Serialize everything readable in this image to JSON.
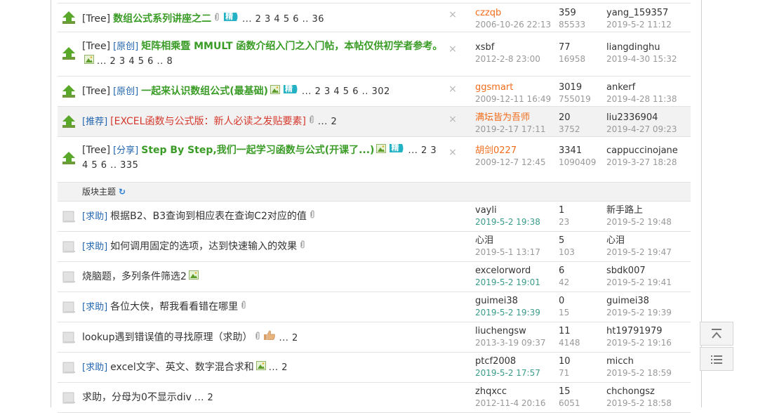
{
  "pinned": [
    {
      "tag": "[Tree]",
      "cat": "",
      "title": "数组公式系列讲座之二",
      "title_style": "green",
      "has_attach": true,
      "has_jing": true,
      "pages": "... 2  3  4  5  6 .. 36",
      "author": "czzqb",
      "author_orange": true,
      "date": "2006-10-26 22:13",
      "replies": "359",
      "views": "85533",
      "last": "yang_159357",
      "last_date": "2019-5-2 11:12",
      "two_line": false,
      "has_img": false
    },
    {
      "tag": "[Tree]",
      "cat": "[原创]",
      "title": "矩阵相乘暨 MMULT 函数介绍入门之入门帖，本帖仅供初学者参考。",
      "title_style": "green",
      "has_attach": false,
      "has_jing": false,
      "has_img": true,
      "pages": "... 2  3  4  5  6 .. 8",
      "author": "xsbf",
      "author_orange": false,
      "date": "2012-2-8 23:00",
      "replies": "77",
      "views": "16958",
      "last": "liangdinghu",
      "last_date": "2019-4-30 15:32",
      "two_line": true
    },
    {
      "tag": "[Tree]",
      "cat": "[原创]",
      "title": "一起来认识数组公式(最基础)",
      "title_style": "green",
      "has_attach": false,
      "has_jing": true,
      "has_img": true,
      "pages": "... 2  3  4  5  6 .. 302",
      "author": "ggsmart",
      "author_orange": true,
      "date": "2009-12-11 16:49",
      "replies": "3019",
      "views": "755019",
      "last": "ankerf",
      "last_date": "2019-4-28 11:38",
      "two_line": false
    },
    {
      "tag": "",
      "cat": "[推荐]",
      "title": "[EXCEL函数与公式版：新人必读之发贴要素]",
      "title_style": "red",
      "has_attach": true,
      "has_jing": false,
      "has_img": false,
      "pages": "... 2",
      "author": "满坛皆为吾师",
      "author_orange": true,
      "date": "2019-2-17 17:11",
      "replies": "20",
      "views": "3752",
      "last": "liu2336904",
      "last_date": "2019-4-27 09:23",
      "two_line": false,
      "highlight": true
    },
    {
      "tag": "[Tree]",
      "cat": "[分享]",
      "title": "Step By Step,我们一起学习函数与公式(开课了...)",
      "title_style": "green",
      "has_attach": false,
      "has_jing": true,
      "has_img": true,
      "pages": "... 2  3  4  5  6 .. 335",
      "author": "胡剑0227",
      "author_orange": true,
      "date": "2009-12-7 12:45",
      "replies": "3341",
      "views": "1090409",
      "last": "cappuccinojane",
      "last_date": "2019-3-27 18:28",
      "two_line": true
    }
  ],
  "section": {
    "label": "版块主题"
  },
  "threads": [
    {
      "cat": "[求助]",
      "title": "根据B2、B3查询到相应表在查询C2对应的值",
      "has_attach": true,
      "has_img": false,
      "has_thumb": false,
      "pages": "",
      "author": "vayli",
      "date": "2019-5-2 19:38",
      "date_new": true,
      "replies": "1",
      "views": "23",
      "last": "新手路上",
      "last_date": "2019-5-2 19:48"
    },
    {
      "cat": "[求助]",
      "title": "如何调用固定的选项，达到快速输入的效果",
      "has_attach": true,
      "has_img": false,
      "has_thumb": false,
      "pages": "",
      "author": "心泪",
      "date": "2019-5-1 13:17",
      "date_new": false,
      "replies": "5",
      "views": "103",
      "last": "心泪",
      "last_date": "2019-5-2 19:47"
    },
    {
      "cat": "",
      "title": "烧脑题，多列条件筛选2",
      "has_attach": false,
      "has_img": true,
      "has_thumb": false,
      "pages": "",
      "author": "excelorword",
      "date": "2019-5-2 19:01",
      "date_new": true,
      "replies": "6",
      "views": "42",
      "last": "sbdk007",
      "last_date": "2019-5-2 19:41"
    },
    {
      "cat": "[求助]",
      "title": "各位大侠，帮我看看错在哪里",
      "has_attach": true,
      "has_img": false,
      "has_thumb": false,
      "pages": "",
      "author": "guimei38",
      "date": "2019-5-2 19:39",
      "date_new": true,
      "replies": "0",
      "views": "15",
      "last": "guimei38",
      "last_date": "2019-5-2 19:39"
    },
    {
      "cat": "",
      "title": "lookup遇到错误值的寻找原理（求助）",
      "has_attach": true,
      "has_img": false,
      "has_thumb": true,
      "pages": "... 2",
      "author": "liuchengsw",
      "date": "2013-3-19 09:37",
      "date_new": false,
      "replies": "11",
      "views": "4148",
      "last": "ht19791979",
      "last_date": "2019-5-2 19:16"
    },
    {
      "cat": "[求助]",
      "title": "excel文字、英文、数字混合求和",
      "has_attach": false,
      "has_img": true,
      "has_thumb": false,
      "pages": "... 2",
      "author": "ptcf2008",
      "date": "2019-5-2 17:57",
      "date_new": true,
      "replies": "10",
      "views": "71",
      "last": "micch",
      "last_date": "2019-5-2 18:59"
    },
    {
      "cat": "",
      "title": "求助，分母为0不显示div",
      "has_attach": false,
      "has_img": false,
      "has_thumb": false,
      "pages": "... 2",
      "author": "zhqxcc",
      "date": "2012-11-4 20:16",
      "date_new": false,
      "replies": "15",
      "views": "6051",
      "last": "chchongsz",
      "last_date": "2019-5-2 18:58"
    }
  ],
  "labels": {
    "jing": "精"
  },
  "icons": {
    "pinned": "pin-up-arrow-icon",
    "normal": "folder-icon",
    "attach": "paperclip-icon",
    "image": "image-icon",
    "thumb": "thumbs-up-icon",
    "refresh": "refresh-icon",
    "close": "close-icon",
    "top": "back-to-top-icon",
    "list": "list-view-icon"
  },
  "colors": {
    "green": "#3a9c26",
    "red": "#d5382c",
    "orange": "#f26c1c",
    "link": "#2366b0"
  }
}
